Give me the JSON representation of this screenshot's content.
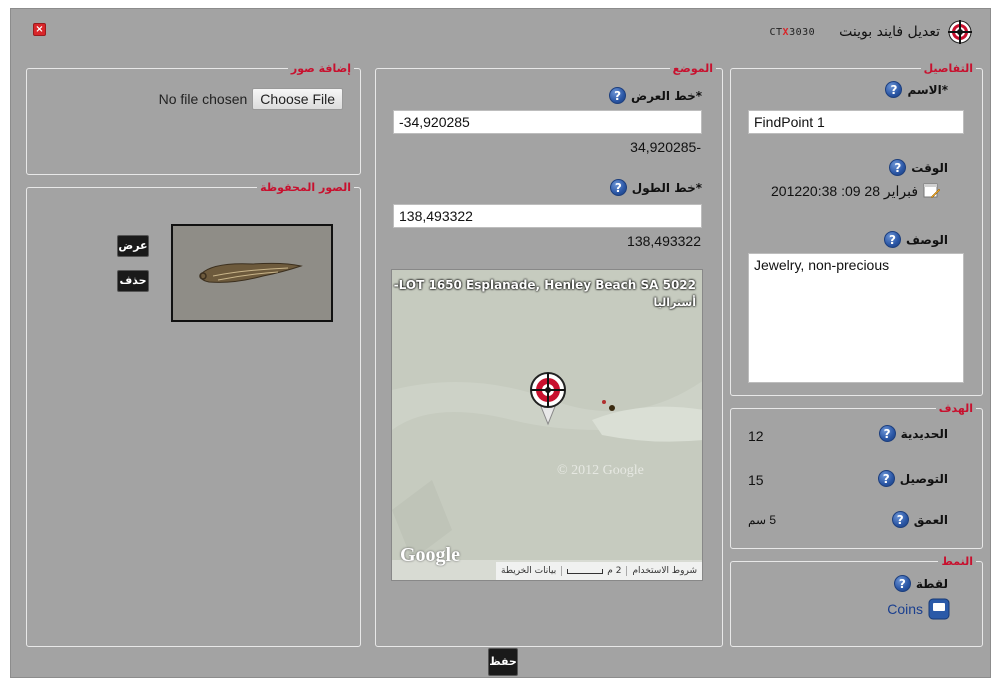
{
  "title": "تعديل فايند بوينت",
  "brand": {
    "prefix": "CT",
    "accent": "X",
    "suffix": "3030"
  },
  "details": {
    "legend": "التفاصيل",
    "name_label": "*الاسم",
    "name_value": "FindPoint 1",
    "time_label": "الوقت",
    "time_value": "201220:38 :09 فبراير 28",
    "description_label": "الوصف",
    "description_value": "Jewelry, non-precious"
  },
  "target": {
    "legend": "الهدف",
    "ferrous_label": "الحديدية",
    "ferrous_value": "12",
    "conductive_label": "التوصيل",
    "conductive_value": "15",
    "depth_label": "العمق",
    "depth_value": "5 سم"
  },
  "pattern": {
    "legend": "النمط",
    "point_label": "لقطة",
    "type_value": "Coins"
  },
  "location": {
    "legend": "الموضع",
    "lat_label": "*خط العرض",
    "lat_input": "-34,920285",
    "lat_display": "34,920285-",
    "lon_label": "*خط الطول",
    "lon_input": "138,493322",
    "lon_display": "138,493322",
    "map": {
      "address_line1": "-LOT 1650 Esplanade, Henley Beach SA 5022",
      "address_line2": "أستراليا",
      "google": "Google",
      "watermark": "© 2012 Google",
      "terms": "شروط الاستخدام",
      "scale": "2 م",
      "map_data": "بيانات الخريطة"
    }
  },
  "add_images": {
    "legend": "إضافة صور",
    "choose_file": "Choose File",
    "no_file": "No file chosen"
  },
  "saved_images": {
    "legend": "الصور المحفوظة",
    "view_button": "عرض",
    "delete_button": "حذف"
  },
  "save_button": "حفظ",
  "colors": {
    "accent": "#c8102e",
    "panel": "#a3a3a3",
    "help_icon": "#2a56a5"
  }
}
